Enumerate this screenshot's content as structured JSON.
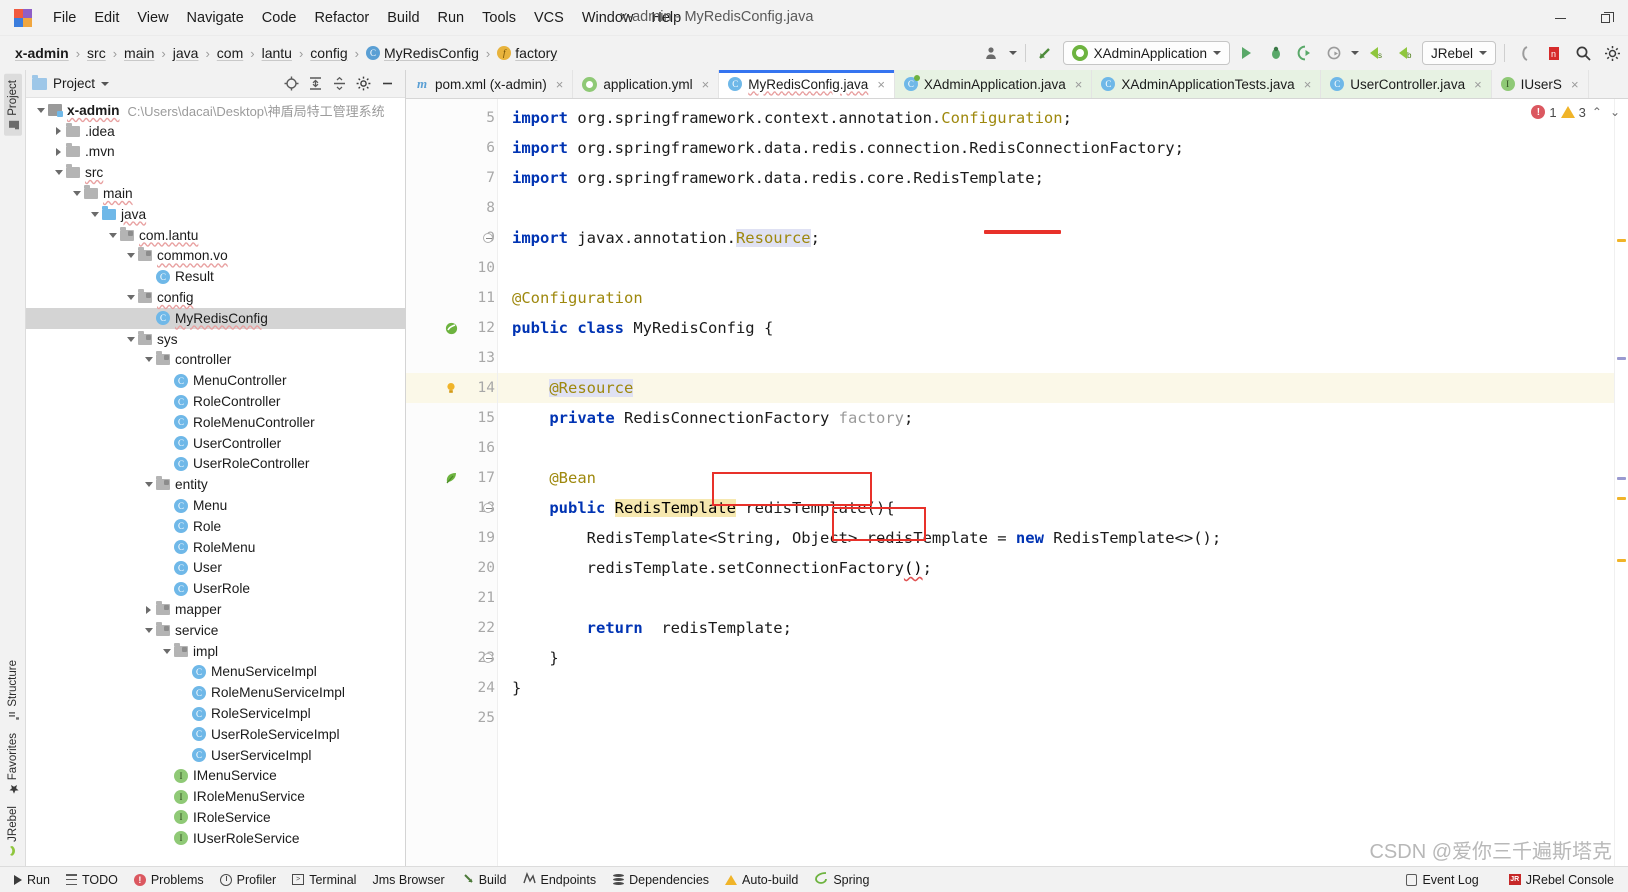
{
  "titlebar": {
    "logo": "intellij-logo",
    "menus": [
      "File",
      "Edit",
      "View",
      "Navigate",
      "Code",
      "Refactor",
      "Build",
      "Run",
      "Tools",
      "VCS",
      "Window",
      "Help"
    ],
    "window_title": "x-admin - MyRedisConfig.java",
    "minimize": "—",
    "restore": "❐"
  },
  "navbar": {
    "breadcrumb": [
      {
        "label": "x-admin",
        "icon": "",
        "bold": true
      },
      {
        "label": "src",
        "icon": "",
        "bold": false
      },
      {
        "label": "main",
        "icon": "",
        "bold": false
      },
      {
        "label": "java",
        "icon": "",
        "bold": false
      },
      {
        "label": "com",
        "icon": "",
        "bold": false
      },
      {
        "label": "lantu",
        "icon": "",
        "bold": false
      },
      {
        "label": "config",
        "icon": "",
        "bold": false
      },
      {
        "label": "MyRedisConfig",
        "icon": "class-icon",
        "bold": false
      },
      {
        "label": "factory",
        "icon": "field-icon",
        "bold": false
      }
    ],
    "separator": "›",
    "run_config": "XAdminApplication",
    "jrebel_label": "JRebel",
    "icons": [
      "user-avatar-icon",
      "back-arrow-icon",
      "run-icon",
      "debug-icon",
      "run-with-coverage-icon",
      "profile-icon",
      "jrebel-run-icon",
      "jrebel-debug-icon",
      "search-icon",
      "settings-icon"
    ]
  },
  "left_strip": {
    "top_tabs": [
      {
        "label": "Project",
        "icon": "project-icon",
        "active": true
      }
    ],
    "bottom_tabs": [
      {
        "label": "Structure",
        "icon": "structure-icon"
      },
      {
        "label": "Favorites",
        "icon": "star-icon"
      },
      {
        "label": "JRebel",
        "icon": "jrebel-icon"
      }
    ]
  },
  "project_panel": {
    "title": "Project",
    "header_icons": [
      "target-icon",
      "collapse-icon",
      "expand-icon",
      "gear-icon",
      "hide-icon"
    ],
    "tree": [
      {
        "depth": 0,
        "arrow": "down",
        "icon": "module-icon",
        "label": "x-admin",
        "bold": true,
        "wavy": true,
        "path": "C:\\Users\\dacai\\Desktop\\神盾局特工管理系统"
      },
      {
        "depth": 1,
        "arrow": "right",
        "icon": "folder-icon",
        "label": ".idea"
      },
      {
        "depth": 1,
        "arrow": "right",
        "icon": "folder-icon",
        "label": ".mvn"
      },
      {
        "depth": 1,
        "arrow": "down",
        "icon": "folder-icon",
        "label": "src",
        "wavy": true
      },
      {
        "depth": 2,
        "arrow": "down",
        "icon": "folder-icon",
        "label": "main",
        "wavy": true
      },
      {
        "depth": 3,
        "arrow": "down",
        "icon": "source-folder-icon",
        "label": "java",
        "wavy": true
      },
      {
        "depth": 4,
        "arrow": "down",
        "icon": "package-icon",
        "label": "com.lantu",
        "wavy": true
      },
      {
        "depth": 5,
        "arrow": "down",
        "icon": "package-icon",
        "label": "common.vo",
        "wavy": true
      },
      {
        "depth": 6,
        "arrow": "",
        "icon": "class-icon",
        "label": "Result"
      },
      {
        "depth": 5,
        "arrow": "down",
        "icon": "package-icon",
        "label": "config",
        "wavy": true
      },
      {
        "depth": 6,
        "arrow": "",
        "icon": "class-icon",
        "label": "MyRedisConfig",
        "selected": true,
        "wavy": true
      },
      {
        "depth": 5,
        "arrow": "down",
        "icon": "package-icon",
        "label": "sys"
      },
      {
        "depth": 6,
        "arrow": "down",
        "icon": "package-icon",
        "label": "controller"
      },
      {
        "depth": 7,
        "arrow": "",
        "icon": "class-icon",
        "label": "MenuController"
      },
      {
        "depth": 7,
        "arrow": "",
        "icon": "class-icon",
        "label": "RoleController"
      },
      {
        "depth": 7,
        "arrow": "",
        "icon": "class-icon",
        "label": "RoleMenuController"
      },
      {
        "depth": 7,
        "arrow": "",
        "icon": "class-icon",
        "label": "UserController"
      },
      {
        "depth": 7,
        "arrow": "",
        "icon": "class-icon",
        "label": "UserRoleController"
      },
      {
        "depth": 6,
        "arrow": "down",
        "icon": "package-icon",
        "label": "entity"
      },
      {
        "depth": 7,
        "arrow": "",
        "icon": "class-icon",
        "label": "Menu"
      },
      {
        "depth": 7,
        "arrow": "",
        "icon": "class-icon",
        "label": "Role"
      },
      {
        "depth": 7,
        "arrow": "",
        "icon": "class-icon",
        "label": "RoleMenu"
      },
      {
        "depth": 7,
        "arrow": "",
        "icon": "class-icon",
        "label": "User"
      },
      {
        "depth": 7,
        "arrow": "",
        "icon": "class-icon",
        "label": "UserRole"
      },
      {
        "depth": 6,
        "arrow": "right",
        "icon": "package-icon",
        "label": "mapper"
      },
      {
        "depth": 6,
        "arrow": "down",
        "icon": "package-icon",
        "label": "service"
      },
      {
        "depth": 7,
        "arrow": "down",
        "icon": "package-icon",
        "label": "impl"
      },
      {
        "depth": 8,
        "arrow": "",
        "icon": "class-icon",
        "label": "MenuServiceImpl"
      },
      {
        "depth": 8,
        "arrow": "",
        "icon": "class-icon",
        "label": "RoleMenuServiceImpl"
      },
      {
        "depth": 8,
        "arrow": "",
        "icon": "class-icon",
        "label": "RoleServiceImpl"
      },
      {
        "depth": 8,
        "arrow": "",
        "icon": "class-icon",
        "label": "UserRoleServiceImpl"
      },
      {
        "depth": 8,
        "arrow": "",
        "icon": "class-icon",
        "label": "UserServiceImpl"
      },
      {
        "depth": 7,
        "arrow": "",
        "icon": "interface-icon",
        "label": "IMenuService"
      },
      {
        "depth": 7,
        "arrow": "",
        "icon": "interface-icon",
        "label": "IRoleMenuService"
      },
      {
        "depth": 7,
        "arrow": "",
        "icon": "interface-icon",
        "label": "IRoleService"
      },
      {
        "depth": 7,
        "arrow": "",
        "icon": "interface-icon",
        "label": "IUserRoleService"
      }
    ]
  },
  "editor_tabs": [
    {
      "label": "pom.xml (x-admin)",
      "icon": "maven-icon",
      "active": false,
      "closable": true
    },
    {
      "label": "application.yml",
      "icon": "yaml-spring-icon",
      "active": false,
      "closable": true
    },
    {
      "label": "MyRedisConfig.java",
      "icon": "class-icon",
      "active": true,
      "closable": true,
      "wavy": true
    },
    {
      "label": "XAdminApplication.java",
      "icon": "spring-class-icon",
      "active": false,
      "closable": true
    },
    {
      "label": "XAdminApplicationTests.java",
      "icon": "class-icon",
      "active": false,
      "closable": true
    },
    {
      "label": "UserController.java",
      "icon": "class-icon",
      "active": false,
      "closable": true
    },
    {
      "label": "IUserS",
      "icon": "interface-icon",
      "active": false,
      "closable": true
    }
  ],
  "inspections": {
    "error_count": "1",
    "warning_count": "3",
    "up_chevron": "⌃",
    "down_chevron": "⌄"
  },
  "code": {
    "first_line_number": 5,
    "lines": [
      {
        "n": 5,
        "gutter_icon": "",
        "fold": false,
        "highlight": false,
        "tokens": [
          {
            "t": "import ",
            "c": "kw"
          },
          {
            "t": "org.springframework.context.annotation.",
            "c": "plain"
          },
          {
            "t": "Configuration",
            "c": "annclass"
          },
          {
            "t": ";",
            "c": "plain"
          }
        ]
      },
      {
        "n": 6,
        "gutter_icon": "",
        "fold": false,
        "highlight": false,
        "tokens": [
          {
            "t": "import ",
            "c": "kw"
          },
          {
            "t": "org.springframework.data.redis.connection.RedisConnectionFactory;",
            "c": "plain"
          }
        ]
      },
      {
        "n": 7,
        "gutter_icon": "",
        "fold": false,
        "highlight": false,
        "tokens": [
          {
            "t": "import ",
            "c": "kw"
          },
          {
            "t": "org.springframework.data.redis.core.RedisTemplate;",
            "c": "plain"
          }
        ]
      },
      {
        "n": 8,
        "gutter_icon": "",
        "fold": false,
        "highlight": false,
        "tokens": []
      },
      {
        "n": 9,
        "gutter_icon": "",
        "fold": true,
        "highlight": false,
        "tokens": [
          {
            "t": "import ",
            "c": "kw"
          },
          {
            "t": "javax.annotation.",
            "c": "plain"
          },
          {
            "t": "Resource",
            "c": "res-hl"
          },
          {
            "t": ";",
            "c": "plain"
          }
        ]
      },
      {
        "n": 10,
        "gutter_icon": "",
        "fold": false,
        "highlight": false,
        "tokens": []
      },
      {
        "n": 11,
        "gutter_icon": "",
        "fold": false,
        "highlight": false,
        "tokens": [
          {
            "t": "@Configuration",
            "c": "ann"
          }
        ]
      },
      {
        "n": 12,
        "gutter_icon": "spring-bean-icon",
        "fold": false,
        "highlight": false,
        "tokens": [
          {
            "t": "public class ",
            "c": "kw"
          },
          {
            "t": "MyRedisConfig {",
            "c": "plain"
          }
        ]
      },
      {
        "n": 13,
        "gutter_icon": "",
        "fold": false,
        "highlight": false,
        "tokens": []
      },
      {
        "n": 14,
        "gutter_icon": "bulb-icon",
        "fold": false,
        "highlight": true,
        "tokens": [
          {
            "t": "    ",
            "c": "plain"
          },
          {
            "t": "@Resource",
            "c": "annhl"
          }
        ]
      },
      {
        "n": 15,
        "gutter_icon": "",
        "fold": false,
        "highlight": false,
        "tokens": [
          {
            "t": "    ",
            "c": "plain"
          },
          {
            "t": "private ",
            "c": "kw"
          },
          {
            "t": "RedisConnectionFactory ",
            "c": "plain"
          },
          {
            "t": "factory",
            "c": "field-grey"
          },
          {
            "t": ";",
            "c": "plain"
          }
        ]
      },
      {
        "n": 16,
        "gutter_icon": "",
        "fold": false,
        "highlight": false,
        "tokens": []
      },
      {
        "n": 17,
        "gutter_icon": "spring-leaf-icon",
        "fold": false,
        "highlight": false,
        "tokens": [
          {
            "t": "    ",
            "c": "plain"
          },
          {
            "t": "@Bean",
            "c": "ann"
          }
        ]
      },
      {
        "n": 18,
        "gutter_icon": "",
        "fold": true,
        "highlight": false,
        "tokens": [
          {
            "t": "    ",
            "c": "plain"
          },
          {
            "t": "public ",
            "c": "kw"
          },
          {
            "t": "RedisTemplate",
            "c": "tpl-hl"
          },
          {
            "t": " redisTemplate(){",
            "c": "plain"
          }
        ]
      },
      {
        "n": 19,
        "gutter_icon": "",
        "fold": false,
        "highlight": false,
        "tokens": [
          {
            "t": "        RedisTemplate<String, Object> redisTemplate = ",
            "c": "plain"
          },
          {
            "t": "new ",
            "c": "kw"
          },
          {
            "t": "RedisTemplate<>();",
            "c": "plain"
          }
        ]
      },
      {
        "n": 20,
        "gutter_icon": "",
        "fold": false,
        "highlight": false,
        "tokens": [
          {
            "t": "        redisTemplate.setConnectionFactory",
            "c": "plain"
          },
          {
            "t": "()",
            "c": "err-sq"
          },
          {
            "t": ";",
            "c": "plain"
          }
        ]
      },
      {
        "n": 21,
        "gutter_icon": "",
        "fold": false,
        "highlight": false,
        "tokens": []
      },
      {
        "n": 22,
        "gutter_icon": "",
        "fold": false,
        "highlight": false,
        "tokens": [
          {
            "t": "        ",
            "c": "plain"
          },
          {
            "t": "return ",
            "c": "kw"
          },
          {
            "t": " redisTemplate;",
            "c": "plain"
          }
        ]
      },
      {
        "n": 23,
        "gutter_icon": "",
        "fold": true,
        "highlight": false,
        "tokens": [
          {
            "t": "    }",
            "c": "plain"
          }
        ]
      },
      {
        "n": 24,
        "gutter_icon": "",
        "fold": false,
        "highlight": false,
        "tokens": [
          {
            "t": "}",
            "c": "plain"
          }
        ]
      },
      {
        "n": 25,
        "gutter_icon": "",
        "fold": false,
        "highlight": false,
        "tokens": []
      }
    ]
  },
  "annotations": {
    "underline_factory": {
      "color": "#e8312a"
    },
    "box_redis_template": {
      "color": "#e8312a"
    },
    "box_string": {
      "color": "#e8312a"
    }
  },
  "statusbar": {
    "items": [
      {
        "label": "Run",
        "icon": "run-icon"
      },
      {
        "label": "TODO",
        "icon": "todo-icon"
      },
      {
        "label": "Problems",
        "icon": "problems-icon"
      },
      {
        "label": "Profiler",
        "icon": "profiler-icon"
      },
      {
        "label": "Terminal",
        "icon": "terminal-icon"
      },
      {
        "label": "Jms Browser",
        "icon": ""
      },
      {
        "label": "Build",
        "icon": "build-icon"
      },
      {
        "label": "Endpoints",
        "icon": "endpoints-icon"
      },
      {
        "label": "Dependencies",
        "icon": "dependencies-icon"
      },
      {
        "label": "Auto-build",
        "icon": "warning-icon"
      },
      {
        "label": "Spring",
        "icon": "spring-icon"
      }
    ],
    "right_items": [
      {
        "label": "Event Log",
        "icon": "event-log-icon"
      },
      {
        "label": "JRebel Console",
        "icon": "jrebel-console-icon"
      }
    ]
  },
  "watermark": "CSDN @爱你三千遍斯塔克",
  "colors": {
    "accent": "#3574f0",
    "annotation_red": "#e8312a",
    "keyword_blue": "#0033b3",
    "annotation_gold": "#9e880d",
    "highlight_yellow": "#fbf8e8",
    "selection_grey": "#d4d4d4"
  }
}
